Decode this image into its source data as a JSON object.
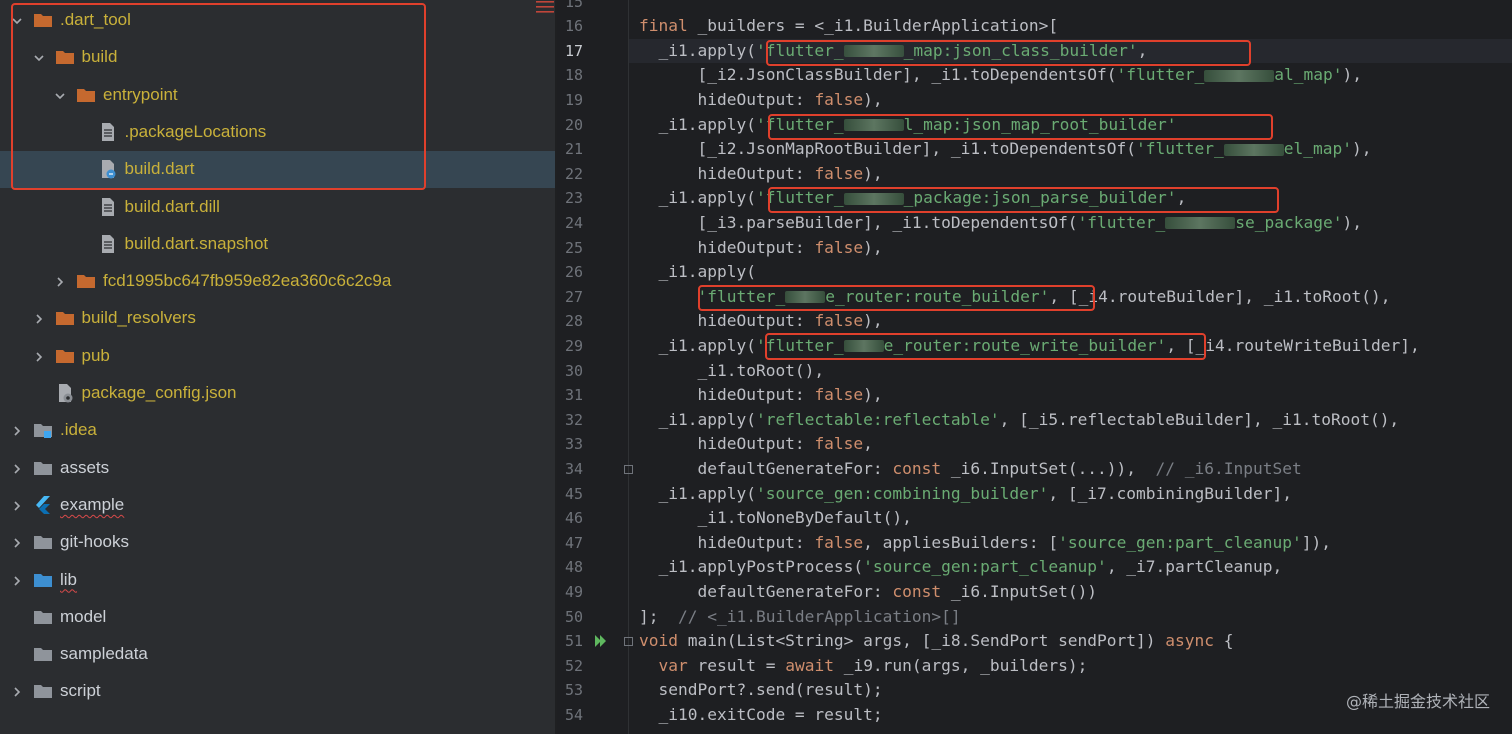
{
  "project_tree": {
    "items": [
      {
        "label": ".dart_tool",
        "indent": 0,
        "chevron": "down",
        "icon": "folder",
        "color": "ignored"
      },
      {
        "label": "build",
        "indent": 1,
        "chevron": "down",
        "icon": "folder",
        "color": "ignored"
      },
      {
        "label": "entrypoint",
        "indent": 2,
        "chevron": "down",
        "icon": "folder",
        "color": "ignored"
      },
      {
        "label": ".packageLocations",
        "indent": 3,
        "chevron": "none",
        "icon": "file",
        "color": "ignored"
      },
      {
        "label": "build.dart",
        "indent": 3,
        "chevron": "none",
        "icon": "dart-file",
        "color": "ignored",
        "selected": true
      },
      {
        "label": "build.dart.dill",
        "indent": 3,
        "chevron": "none",
        "icon": "file",
        "color": "ignored"
      },
      {
        "label": "build.dart.snapshot",
        "indent": 3,
        "chevron": "none",
        "icon": "file",
        "color": "ignored"
      },
      {
        "label": "fcd1995bc647fb959e82ea360c6c2c9a",
        "indent": 2,
        "chevron": "right",
        "icon": "folder",
        "color": "ignored"
      },
      {
        "label": "build_resolvers",
        "indent": 1,
        "chevron": "right",
        "icon": "folder",
        "color": "ignored"
      },
      {
        "label": "pub",
        "indent": 1,
        "chevron": "right",
        "icon": "folder",
        "color": "ignored"
      },
      {
        "label": "package_config.json",
        "indent": 1,
        "chevron": "none",
        "icon": "json-file",
        "color": "ignored"
      },
      {
        "label": ".idea",
        "indent": 0,
        "chevron": "right",
        "icon": "folder-idea",
        "color": "ignored"
      },
      {
        "label": "assets",
        "indent": 0,
        "chevron": "right",
        "icon": "folder-gray",
        "color": "normal"
      },
      {
        "label": "example",
        "indent": 0,
        "chevron": "right",
        "icon": "flutter-icon",
        "color": "normal",
        "squiggle": true
      },
      {
        "label": "git-hooks",
        "indent": 0,
        "chevron": "right",
        "icon": "folder-gray",
        "color": "normal"
      },
      {
        "label": "lib",
        "indent": 0,
        "chevron": "right",
        "icon": "folder-blue",
        "color": "normal",
        "squiggle": true
      },
      {
        "label": "model",
        "indent": 0,
        "chevron": "none",
        "icon": "folder-gray",
        "color": "normal"
      },
      {
        "label": "sampledata",
        "indent": 0,
        "chevron": "none",
        "icon": "folder-gray",
        "color": "normal"
      },
      {
        "label": "script",
        "indent": 0,
        "chevron": "right",
        "icon": "folder-gray",
        "color": "normal"
      }
    ]
  },
  "colors": {
    "ignored_text": "#c9b13a",
    "normal_text": "#cdd1d7",
    "folder_orange": "#c5692f",
    "folder_gray": "#8f949b",
    "folder_blue": "#3d8fd1",
    "highlight_red": "#e0402c",
    "keyword": "#cf8e6d",
    "string": "#6aab73",
    "comment": "#7a7e85"
  },
  "editor": {
    "line_numbers": [
      "15",
      "16",
      "17",
      "18",
      "19",
      "20",
      "21",
      "22",
      "23",
      "24",
      "25",
      "26",
      "27",
      "28",
      "29",
      "30",
      "31",
      "32",
      "33",
      "34",
      "45",
      "46",
      "47",
      "48",
      "49",
      "50",
      "51",
      "52",
      "53",
      "54"
    ],
    "current_line": "17",
    "lines": [
      [],
      [
        {
          "t": "final",
          "c": "kw"
        },
        {
          "t": " _builders = <_i1.BuilderApplication>["
        }
      ],
      [
        {
          "t": "  _i1.apply("
        },
        {
          "t": "'flutter_",
          "c": "st"
        },
        {
          "blur": 60
        },
        {
          "t": "_map:json_class_builder'",
          "c": "st"
        },
        {
          "t": ","
        }
      ],
      [
        {
          "t": "      [_i2.JsonClassBuilder], _i1.toDependentsOf("
        },
        {
          "t": "'flutter_",
          "c": "st"
        },
        {
          "blur": 70
        },
        {
          "t": "al_map'",
          "c": "st"
        },
        {
          "t": "),"
        }
      ],
      [
        {
          "t": "      hideOutput: "
        },
        {
          "t": "false",
          "c": "kw"
        },
        {
          "t": "),"
        }
      ],
      [
        {
          "t": "  _i1.apply("
        },
        {
          "t": "'flutter_",
          "c": "st"
        },
        {
          "blur": 60
        },
        {
          "t": "l_map:json_map_root_builder'",
          "c": "st"
        }
      ],
      [
        {
          "t": "      [_i2.JsonMapRootBuilder], _i1.toDependentsOf("
        },
        {
          "t": "'flutter_",
          "c": "st"
        },
        {
          "blur": 60
        },
        {
          "t": "el_map'",
          "c": "st"
        },
        {
          "t": "),"
        }
      ],
      [
        {
          "t": "      hideOutput: "
        },
        {
          "t": "false",
          "c": "kw"
        },
        {
          "t": "),"
        }
      ],
      [
        {
          "t": "  _i1.apply("
        },
        {
          "t": "'flutter_",
          "c": "st"
        },
        {
          "blur": 60
        },
        {
          "t": "_package:json_parse_builder'",
          "c": "st"
        },
        {
          "t": ","
        }
      ],
      [
        {
          "t": "      [_i3.parseBuilder], _i1.toDependentsOf("
        },
        {
          "t": "'flutter_",
          "c": "st"
        },
        {
          "blur": 70
        },
        {
          "t": "se_package'",
          "c": "st"
        },
        {
          "t": "),"
        }
      ],
      [
        {
          "t": "      hideOutput: "
        },
        {
          "t": "false",
          "c": "kw"
        },
        {
          "t": "),"
        }
      ],
      [
        {
          "t": "  _i1.apply("
        }
      ],
      [
        {
          "t": "      "
        },
        {
          "t": "'flutter_",
          "c": "st"
        },
        {
          "blur": 40
        },
        {
          "t": "e_router:route_builder'",
          "c": "st"
        },
        {
          "t": ", [_i4.routeBuilder], _i1.toRoot(),"
        }
      ],
      [
        {
          "t": "      hideOutput: "
        },
        {
          "t": "false",
          "c": "kw"
        },
        {
          "t": "),"
        }
      ],
      [
        {
          "t": "  _i1.apply("
        },
        {
          "t": "'flutter_",
          "c": "st"
        },
        {
          "blur": 40
        },
        {
          "t": "e_router:route_write_builder'",
          "c": "st"
        },
        {
          "t": ", [_i4.routeWriteBuilder],"
        }
      ],
      [
        {
          "t": "      _i1.toRoot(),"
        }
      ],
      [
        {
          "t": "      hideOutput: "
        },
        {
          "t": "false",
          "c": "kw"
        },
        {
          "t": "),"
        }
      ],
      [
        {
          "t": "  _i1.apply("
        },
        {
          "t": "'reflectable:reflectable'",
          "c": "st"
        },
        {
          "t": ", [_i5.reflectableBuilder], _i1.toRoot(),"
        }
      ],
      [
        {
          "t": "      hideOutput: "
        },
        {
          "t": "false",
          "c": "kw"
        },
        {
          "t": ","
        }
      ],
      [
        {
          "t": "      defaultGenerateFor: "
        },
        {
          "t": "const",
          "c": "kw"
        },
        {
          "t": " _i6.InputSet(...)),  "
        },
        {
          "t": "// _i6.InputSet",
          "c": "cm"
        }
      ],
      [
        {
          "t": "  _i1.apply("
        },
        {
          "t": "'source_gen:combining_builder'",
          "c": "st"
        },
        {
          "t": ", [_i7.combiningBuilder],"
        }
      ],
      [
        {
          "t": "      _i1.toNoneByDefault(),"
        }
      ],
      [
        {
          "t": "      hideOutput: "
        },
        {
          "t": "false",
          "c": "kw"
        },
        {
          "t": ", appliesBuilders: ["
        },
        {
          "t": "'source_gen:part_cleanup'",
          "c": "st"
        },
        {
          "t": "]),"
        }
      ],
      [
        {
          "t": "  _i1.applyPostProcess("
        },
        {
          "t": "'source_gen:part_cleanup'",
          "c": "st"
        },
        {
          "t": ", _i7.partCleanup,"
        }
      ],
      [
        {
          "t": "      defaultGenerateFor: "
        },
        {
          "t": "const",
          "c": "kw"
        },
        {
          "t": " _i6.InputSet())"
        }
      ],
      [
        {
          "t": "];  "
        },
        {
          "t": "// <_i1.BuilderApplication>[]",
          "c": "cm"
        }
      ],
      [
        {
          "t": "void",
          "c": "kw"
        },
        {
          "t": " main(List<String> args, [_i8.SendPort sendPort]) "
        },
        {
          "t": "async",
          "c": "kw"
        },
        {
          "t": " {"
        }
      ],
      [
        {
          "t": "  "
        },
        {
          "t": "var",
          "c": "kw"
        },
        {
          "t": " result = "
        },
        {
          "t": "await",
          "c": "kw"
        },
        {
          "t": " _i9.run(args, _builders);"
        }
      ],
      [
        {
          "t": "  sendPort?.send(result);"
        }
      ],
      [
        {
          "t": "  _i10.exitCode = result;"
        }
      ]
    ]
  },
  "watermark": "@稀土掘金技术社区"
}
